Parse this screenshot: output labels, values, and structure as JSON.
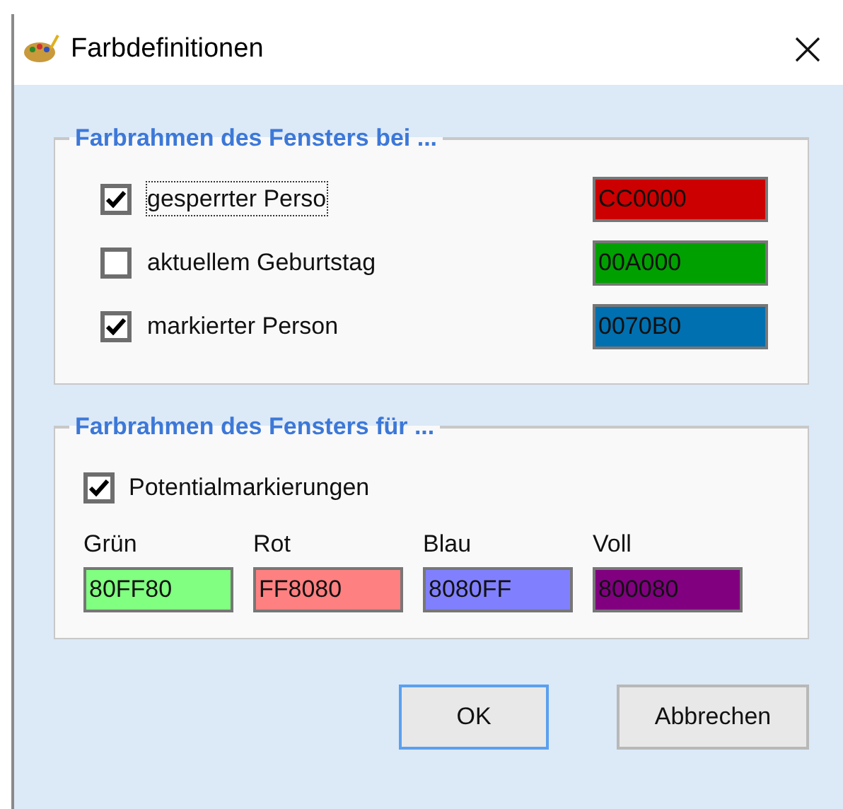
{
  "window": {
    "title": "Farbdefinitionen"
  },
  "groups": [
    {
      "title": "Farbrahmen des Fensters bei ...",
      "kind": "rows",
      "items": [
        {
          "label": "gesperrter Perso",
          "checked": true,
          "focused": true,
          "value": "CC0000",
          "color": "#cc0000"
        },
        {
          "label": "aktuellem Geburtstag",
          "checked": false,
          "focused": false,
          "value": "00A000",
          "color": "#00a000"
        },
        {
          "label": "markierter Person",
          "checked": true,
          "focused": false,
          "value": "0070B0",
          "color": "#0070b0"
        }
      ]
    },
    {
      "title": "Farbrahmen des Fensters für ...",
      "kind": "columns",
      "checkbox": {
        "label": "Potentialmarkierungen",
        "checked": true
      },
      "items": [
        {
          "label": "Grün",
          "value": "80FF80",
          "color": "#80ff80"
        },
        {
          "label": "Rot",
          "value": "FF8080",
          "color": "#ff8080"
        },
        {
          "label": "Blau",
          "value": "8080FF",
          "color": "#8080ff"
        },
        {
          "label": "Voll",
          "value": "800080",
          "color": "#800080"
        }
      ]
    }
  ],
  "buttons": [
    {
      "label": "OK",
      "default": true
    },
    {
      "label": "Abbrechen",
      "default": false
    }
  ]
}
